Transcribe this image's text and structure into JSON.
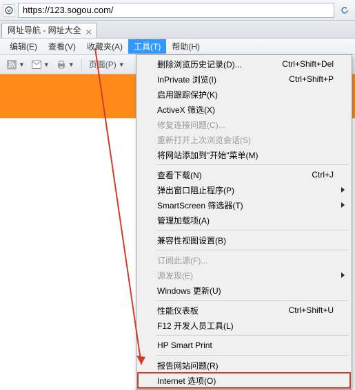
{
  "address": {
    "url": "https://123.sogou.com/"
  },
  "tab": {
    "title": "网址导航 - 网址大全"
  },
  "menubar": {
    "edit": "编辑(E)",
    "view": "查看(V)",
    "favorites": "收藏夹(A)",
    "tools": "工具(T)",
    "help": "帮助(H)"
  },
  "toolbar": {
    "page_label": "页面(P)"
  },
  "dropdown": {
    "delete_history": {
      "label": "删除浏览历史记录(D)...",
      "shortcut": "Ctrl+Shift+Del"
    },
    "inprivate": {
      "label": "InPrivate 浏览(I)",
      "shortcut": "Ctrl+Shift+P"
    },
    "tracking_protection": {
      "label": "启用跟踪保护(K)"
    },
    "activex_filter": {
      "label": "ActiveX 筛选(X)"
    },
    "fix_connection": {
      "label": "修复连接问题(C)..."
    },
    "reopen_last": {
      "label": "重新打开上次浏览会话(S)"
    },
    "add_to_start": {
      "label": "将网站添加到\"开始\"菜单(M)"
    },
    "view_downloads": {
      "label": "查看下载(N)",
      "shortcut": "Ctrl+J"
    },
    "popup_blocker": {
      "label": "弹出窗口阻止程序(P)"
    },
    "smartscreen": {
      "label": "SmartScreen 筛选器(T)"
    },
    "manage_addons": {
      "label": "管理加载项(A)"
    },
    "compat_view": {
      "label": "兼容性视图设置(B)"
    },
    "subscribe_feed": {
      "label": "订阅此源(F)..."
    },
    "feed_discovery": {
      "label": "源发现(E)"
    },
    "windows_update": {
      "label": "Windows 更新(U)"
    },
    "perf_dashboard": {
      "label": "性能仪表板",
      "shortcut": "Ctrl+Shift+U"
    },
    "f12_tools": {
      "label": "F12 开发人员工具(L)"
    },
    "hp_smart_print": {
      "label": "HP Smart Print"
    },
    "report_site": {
      "label": "报告网站问题(R)"
    },
    "internet_options": {
      "label": "Internet 选项(O)"
    }
  }
}
